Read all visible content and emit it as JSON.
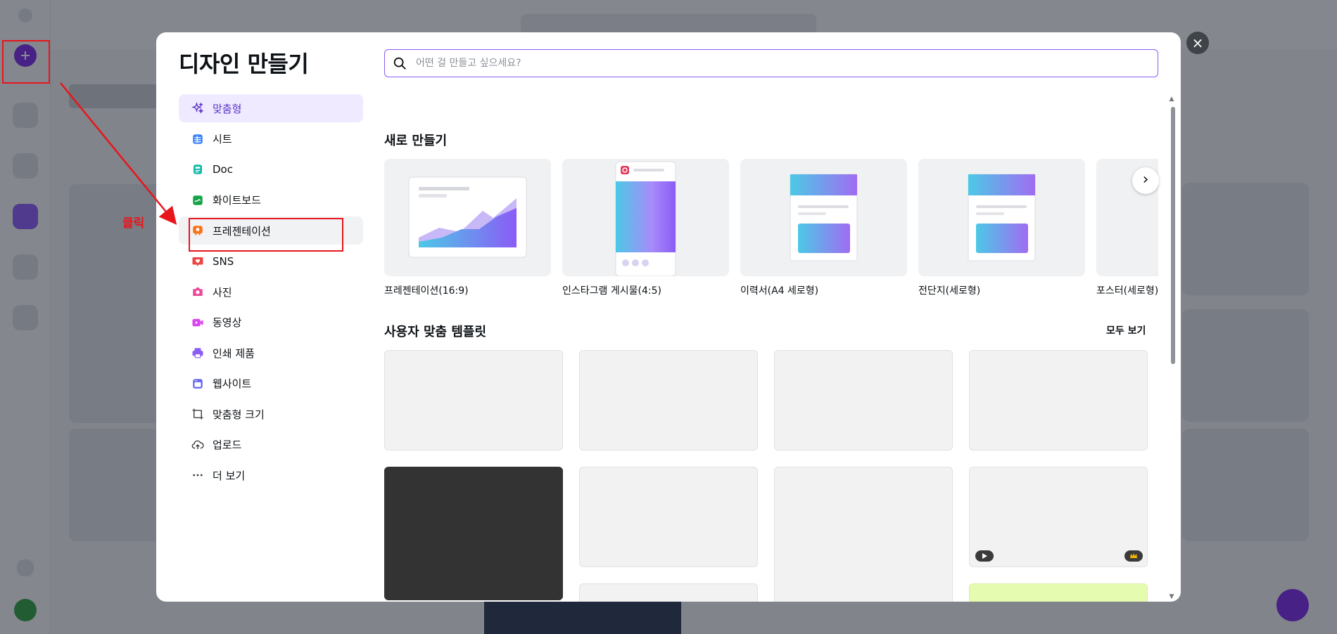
{
  "modal": {
    "title": "디자인 만들기",
    "close_label": "×",
    "search_placeholder": "어떤 걸 만들고 싶으세요?"
  },
  "sidebar": {
    "items": [
      {
        "label": "맞춤형",
        "icon": "sparkle-icon",
        "color": "#5a32c8"
      },
      {
        "label": "시트",
        "icon": "sheet-icon",
        "color": "#3b82f6"
      },
      {
        "label": "Doc",
        "icon": "doc-icon",
        "color": "#14b8a6"
      },
      {
        "label": "화이트보드",
        "icon": "whiteboard-icon",
        "color": "#16a34a"
      },
      {
        "label": "프레젠테이션",
        "icon": "presentation-icon",
        "color": "#f97316"
      },
      {
        "label": "SNS",
        "icon": "heart-chat-icon",
        "color": "#ef4444"
      },
      {
        "label": "사진",
        "icon": "camera-icon",
        "color": "#ec4899"
      },
      {
        "label": "동영상",
        "icon": "video-icon",
        "color": "#d946ef"
      },
      {
        "label": "인쇄 제품",
        "icon": "printer-icon",
        "color": "#8b5cf6"
      },
      {
        "label": "웹사이트",
        "icon": "website-icon",
        "color": "#6366f1"
      },
      {
        "label": "맞춤형 크기",
        "icon": "custom-size-icon",
        "color": "#333333"
      },
      {
        "label": "업로드",
        "icon": "cloud-upload-icon",
        "color": "#333333"
      },
      {
        "label": "더 보기",
        "icon": "more-dots-icon",
        "color": "#333333"
      }
    ]
  },
  "new_section": {
    "title": "새로 만들기",
    "cards": [
      {
        "label": "프레젠테이션(16:9)"
      },
      {
        "label": "인스타그램 게시물(4:5)"
      },
      {
        "label": "이력서(A4 세로형)"
      },
      {
        "label": "전단지(세로형)"
      },
      {
        "label": "포스터(세로형)"
      }
    ],
    "next_label": "›"
  },
  "templates_section": {
    "title": "사용자 맞춤 템플릿",
    "see_all": "모두 보기"
  },
  "annotation": {
    "click_label": "클릭",
    "color": "#e8151b"
  },
  "colors": {
    "accent": "#7d2ae8",
    "search_border": "#8b5cf6",
    "active_bg": "#efeaff"
  }
}
